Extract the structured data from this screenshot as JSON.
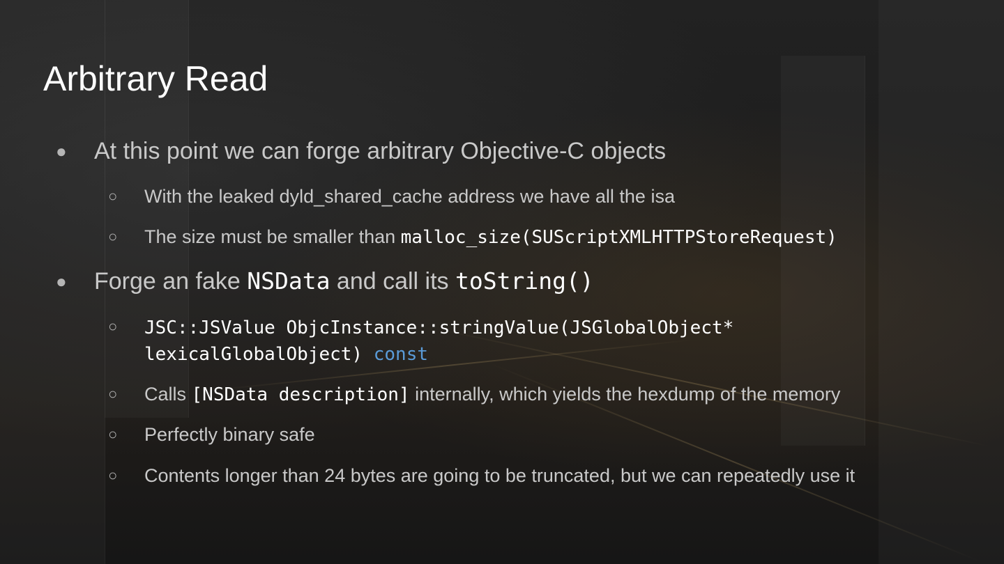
{
  "slide": {
    "title": "Arbitrary Read",
    "b1": {
      "text": "At this point we can forge arbitrary Objective-C objects"
    },
    "b1a": {
      "text": "With the leaked dyld_shared_cache address we have all the isa"
    },
    "b1b": {
      "pre": "The size must be smaller than ",
      "code": "malloc_size(SUScriptXMLHTTPStoreRequest)"
    },
    "b2": {
      "pre": "Forge an fake ",
      "code1": "NSData",
      "mid": " and call its ",
      "code2": "toString()"
    },
    "b2a": {
      "line1": "JSC::JSValue ObjcInstance::stringValue(JSGlobalObject*",
      "line2": "lexicalGlobalObject) ",
      "keyword": "const"
    },
    "b2b": {
      "pre": "Calls ",
      "code": "[NSData description]",
      "post": " internally, which yields the hexdump of the memory"
    },
    "b2c": {
      "text": "Perfectly binary safe"
    },
    "b2d": {
      "text": "Contents longer than 24 bytes are going to be truncated, but we can repeatedly use it"
    },
    "bullet_l1": "●",
    "bullet_l2": "○"
  },
  "colors": {
    "keyword": "#5a9bd8",
    "text": "#c9c9c9",
    "title": "#ffffff"
  }
}
